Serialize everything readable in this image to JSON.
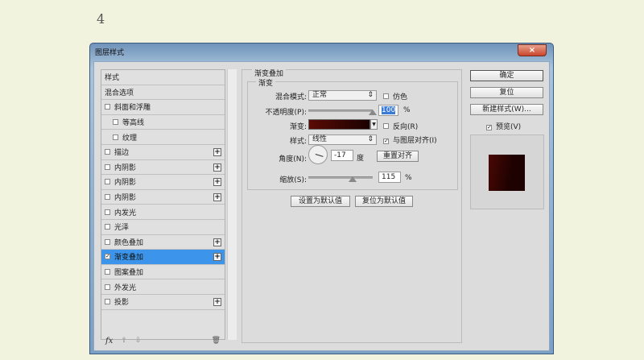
{
  "page_number": "4",
  "window": {
    "title": "图层样式",
    "close": "×"
  },
  "sidebar": {
    "items": [
      {
        "label": "样式",
        "checkbox": false,
        "checked": false,
        "plus": false,
        "indent": false
      },
      {
        "label": "混合选项",
        "checkbox": false,
        "checked": false,
        "plus": false,
        "indent": false
      },
      {
        "label": "斜面和浮雕",
        "checkbox": true,
        "checked": false,
        "plus": false,
        "indent": false
      },
      {
        "label": "等高线",
        "checkbox": true,
        "checked": false,
        "plus": false,
        "indent": true
      },
      {
        "label": "纹理",
        "checkbox": true,
        "checked": false,
        "plus": false,
        "indent": true
      },
      {
        "label": "描边",
        "checkbox": true,
        "checked": false,
        "plus": true,
        "indent": false
      },
      {
        "label": "内阴影",
        "checkbox": true,
        "checked": false,
        "plus": true,
        "indent": false
      },
      {
        "label": "内阴影",
        "checkbox": true,
        "checked": false,
        "plus": true,
        "indent": false
      },
      {
        "label": "内阴影",
        "checkbox": true,
        "checked": false,
        "plus": true,
        "indent": false
      },
      {
        "label": "内发光",
        "checkbox": true,
        "checked": false,
        "plus": false,
        "indent": false
      },
      {
        "label": "光泽",
        "checkbox": true,
        "checked": false,
        "plus": false,
        "indent": false
      },
      {
        "label": "颜色叠加",
        "checkbox": true,
        "checked": false,
        "plus": true,
        "indent": false
      },
      {
        "label": "渐变叠加",
        "checkbox": true,
        "checked": true,
        "plus": true,
        "indent": false,
        "selected": true
      },
      {
        "label": "图案叠加",
        "checkbox": true,
        "checked": false,
        "plus": false,
        "indent": false
      },
      {
        "label": "外发光",
        "checkbox": true,
        "checked": false,
        "plus": false,
        "indent": false
      },
      {
        "label": "投影",
        "checkbox": true,
        "checked": false,
        "plus": true,
        "indent": false
      }
    ],
    "fx": "fx"
  },
  "panel": {
    "section": "渐变叠加",
    "group": "渐变",
    "blend_label": "混合模式:",
    "blend_value": "正常",
    "dither_label": "仿色",
    "opacity_label": "不透明度(P):",
    "opacity_value": "100",
    "opacity_percent": 100,
    "pct": "%",
    "gradient_label": "渐变:",
    "reverse_label": "反向(R)",
    "style_label": "样式:",
    "style_value": "线性",
    "align_label": "与图层对齐(I)",
    "angle_label": "角度(N):",
    "angle_value": "-17",
    "angle_unit": "度",
    "reset_align": "重置对齐",
    "scale_label": "缩放(S):",
    "scale_value": "115",
    "scale_percent": 115,
    "set_default": "设置为默认值",
    "reset_default": "复位为默认值",
    "gradient_colors": [
      "#5a0a04",
      "#1a0201"
    ]
  },
  "right": {
    "ok": "确定",
    "reset": "复位",
    "new_style": "新建样式(W)...",
    "preview": "预览(V)"
  },
  "colors": {
    "selection": "#3c95ea"
  }
}
